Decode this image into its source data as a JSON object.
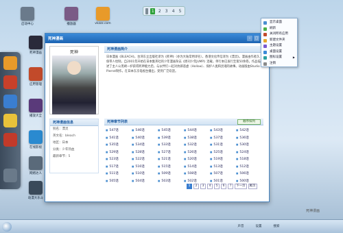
{
  "pager_top": {
    "pages": [
      "1",
      "2",
      "3",
      "4",
      "5"
    ],
    "active_index": 0
  },
  "desktop_icons": [
    {
      "label": "启动中心",
      "color": "#6a7a8b"
    },
    {
      "label": "播放器",
      "color": "#7a5b86"
    },
    {
      "label": "vkzzz.com",
      "color": "#e89a2a"
    },
    {
      "label": "死神漫画",
      "color": "#2a2a3a"
    },
    {
      "label": "应用管理",
      "color": "#c24a2a"
    },
    {
      "label": "播放大全",
      "color": "#5a3a7a"
    },
    {
      "label": "在线影视",
      "color": "#2a8ad0"
    },
    {
      "label": "网络达人",
      "color": "#5a6a7a"
    },
    {
      "label": "动漫大乐斗",
      "color": "#3a4a5a"
    }
  ],
  "dock_icons": [
    {
      "name": "orange-circle-icon",
      "color": "#e89a2a"
    },
    {
      "name": "search-icon",
      "color": "#c8402a"
    },
    {
      "name": "arrow-icon",
      "color": "#3a7ed0"
    },
    {
      "name": "notes-icon",
      "color": "#e8c23a"
    },
    {
      "name": "calendar-icon",
      "color": "#c23a2a"
    },
    {
      "name": "settings-icon",
      "color": "#6a7a8a"
    }
  ],
  "window": {
    "title": "死神漫画",
    "cover_name": "死神",
    "intro_title": "死神漫画简介",
    "intro_text": "日本漫画《BLEACH》，台湾东立出版社译为《死神》（亦为大陆常用译名），香港文化传信译为《漂灵》。漫画由作者久保带人绘制，自2001年开始在日本集英社的少年漫画杂志《周刊少年JUMP》连载，单行本已发行至第50余卷。作品描述了主人公黑崎一护获得死神能力后，与伙伴们一起对抗邪恶虚（Hollow）、保护人类和灵魂的故事。动画版由Studio Pierrot制作，在日本东京电视台播出，受到广泛欢迎。",
    "info_title": "死神漫画信息",
    "info_rows": [
      "别名：漂灵",
      "英文名：bleach",
      "地区：日本",
      "分类：少年热血",
      "最新章节：5"
    ],
    "eps_title": "死神章节列表",
    "order_button": "顺序排列",
    "episodes": [
      "547话",
      "546话",
      "545话",
      "544话",
      "543话",
      "542话",
      "541话",
      "540话",
      "539话",
      "538话",
      "537话",
      "536话",
      "535话",
      "534话",
      "533话",
      "532话",
      "531话",
      "530话",
      "529话",
      "528话",
      "527话",
      "526话",
      "525话",
      "524话",
      "523话",
      "522话",
      "521话",
      "520话",
      "519话",
      "518话",
      "517话",
      "516话",
      "515话",
      "514话",
      "513话",
      "512话",
      "511话",
      "510话",
      "509话",
      "508话",
      "507话",
      "506话",
      "505话",
      "504话",
      "503话",
      "502话",
      "501话",
      "500话"
    ],
    "pager": [
      "1",
      "2",
      "3",
      "4",
      "5",
      "6",
      "7",
      "下一页",
      "尾页"
    ],
    "pager_active": 0
  },
  "context_menu": {
    "items": [
      {
        "label": "显示桌面",
        "color": "#4a8fd0",
        "has_arrow": false
      },
      {
        "label": "刷新",
        "color": "#4ab04a",
        "has_arrow": false
      },
      {
        "label": "关闭所有应用",
        "color": "#c24a2a",
        "has_arrow": false
      },
      {
        "label": "新建文件夹",
        "color": "#e8a82a",
        "has_arrow": false
      },
      {
        "label": "主题设置",
        "color": "#7a5ad0",
        "has_arrow": false
      },
      {
        "label": "桌面设置",
        "color": "#3a8ad8",
        "has_arrow": false
      },
      {
        "label": "图标设置",
        "color": "#2aa0a0",
        "has_arrow": true
      },
      {
        "label": "注销",
        "color": "#8a8a8a",
        "has_arrow": false
      }
    ]
  },
  "taskbar": {
    "items": [
      "声音",
      "设置",
      "搜索"
    ],
    "watermark": "死神漫画"
  }
}
